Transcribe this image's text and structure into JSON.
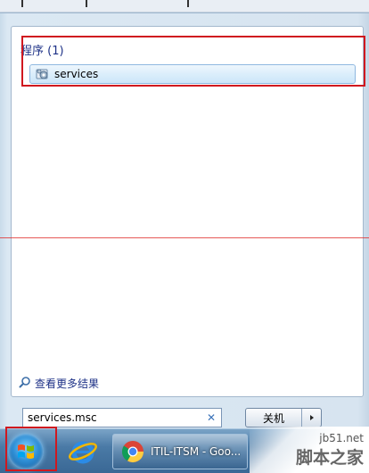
{
  "results": {
    "section_title": "程序 (1)",
    "items": [
      {
        "label": "services",
        "icon": "services-gear-icon"
      }
    ],
    "see_more_label": "查看更多结果"
  },
  "search": {
    "value": "services.msc"
  },
  "shutdown": {
    "label": "关机"
  },
  "taskbar": {
    "chrome_task_label": "ITIL-ITSM - Goo..."
  },
  "watermark": {
    "url": "jb51.net",
    "name": "脚本之家"
  },
  "colors": {
    "highlight_red": "#d0181f",
    "section_title_blue": "#1e3287",
    "selected_item_bg": "#dbeefb"
  }
}
